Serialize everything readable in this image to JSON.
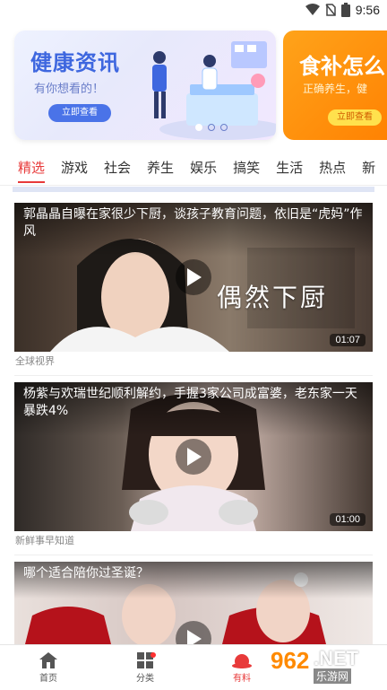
{
  "status_bar": {
    "time": "9:56"
  },
  "banner": {
    "cards": [
      {
        "title": "健康资讯",
        "subtitle": "有你想看的！",
        "button": "立即查看"
      },
      {
        "title": "食补怎么",
        "subtitle": "正确养生，健",
        "button": "立即查看"
      }
    ],
    "active_index": 0,
    "dot_count": 3
  },
  "tabs": [
    "精选",
    "游戏",
    "社会",
    "养生",
    "娱乐",
    "搞笑",
    "生活",
    "热点",
    "新"
  ],
  "active_tab": 0,
  "feed": [
    {
      "headline": "郭晶晶自曝在家很少下厨，谈孩子教育问题，依旧是“虎妈”作风",
      "overlay": "偶然下厨",
      "duration": "01:07",
      "source": "全球视界"
    },
    {
      "headline": "杨紫与欢瑞世纪顺利解约，手握3家公司成富婆，老东家一天暴跌4%",
      "overlay": "",
      "duration": "01:00",
      "source": "新鲜事早知道"
    },
    {
      "headline": "哪个适合陪你过圣诞？",
      "overlay": "",
      "duration": "",
      "source": ""
    }
  ],
  "bottom_nav": [
    {
      "label": "首页",
      "icon": "home-icon"
    },
    {
      "label": "分类",
      "icon": "grid-icon"
    },
    {
      "label": "有料",
      "icon": "hat-icon"
    }
  ],
  "watermark": {
    "number": "962",
    "suffix": ".NET",
    "text": "乐游网"
  },
  "colors": {
    "accent": "#e83a3a",
    "banner_blue": "#3e67df",
    "banner_orange": "#ff8a00"
  }
}
